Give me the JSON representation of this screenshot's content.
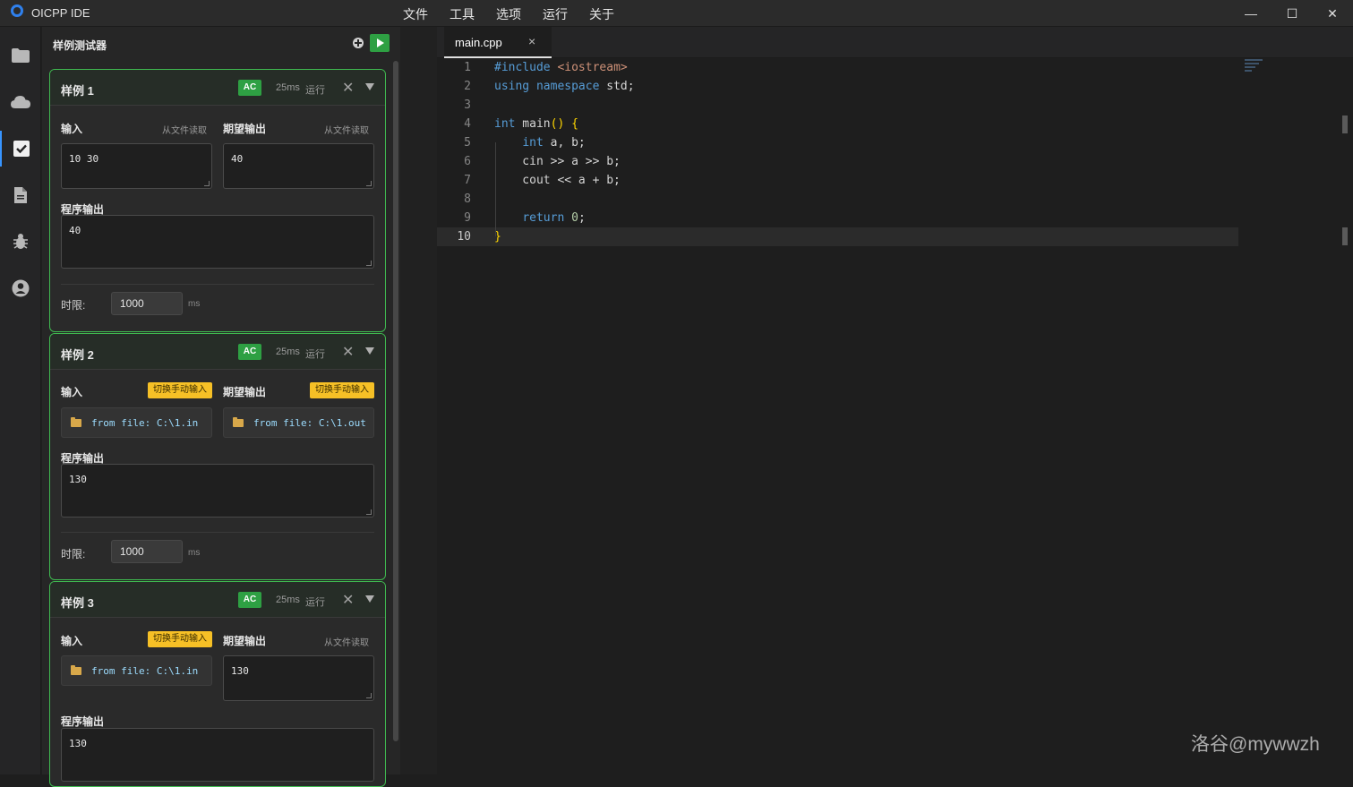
{
  "titlebar": {
    "app_title": "OICPP IDE",
    "menu": [
      "文件",
      "工具",
      "选项",
      "运行",
      "关于"
    ],
    "minimize": "—",
    "maximize": "☐",
    "close": "✕"
  },
  "activity_bar": [
    "folder-icon",
    "cloud-icon",
    "checkbox-icon",
    "file-icon",
    "bug-icon",
    "user-icon"
  ],
  "panel": {
    "title": "样例测试器",
    "cases": [
      {
        "title": "样例 1",
        "status": "AC",
        "time": "25ms",
        "run": "运行",
        "input_label": "输入",
        "input_action": "从文件读取",
        "input_value": "10 30",
        "expected_label": "期望输出",
        "expected_action": "从文件读取",
        "expected_value": "40",
        "output_label": "程序输出",
        "output_value": "40",
        "limit_label": "时限:",
        "limit_value": "1000",
        "limit_unit": "ms"
      },
      {
        "title": "样例 2",
        "status": "AC",
        "time": "25ms",
        "run": "运行",
        "input_label": "输入",
        "input_action": "切换手动输入",
        "input_value": "from file: C:\\1.in",
        "expected_label": "期望输出",
        "expected_action": "切换手动输入",
        "expected_value": "from file: C:\\1.out",
        "output_label": "程序输出",
        "output_value": "130",
        "limit_label": "时限:",
        "limit_value": "1000",
        "limit_unit": "ms"
      },
      {
        "title": "样例 3",
        "status": "AC",
        "time": "25ms",
        "run": "运行",
        "input_label": "输入",
        "input_action": "切换手动输入",
        "input_value": "from file: C:\\1.in",
        "expected_label": "期望输出",
        "expected_action": "从文件读取",
        "expected_value": "130",
        "output_label": "程序输出",
        "output_value": "130"
      }
    ]
  },
  "editor": {
    "tab": "main.cpp",
    "tab_close": "×",
    "line_numbers": [
      "1",
      "2",
      "3",
      "4",
      "5",
      "6",
      "7",
      "8",
      "9",
      "10"
    ],
    "current_line": "10"
  },
  "watermark": "洛谷@mywwzh"
}
